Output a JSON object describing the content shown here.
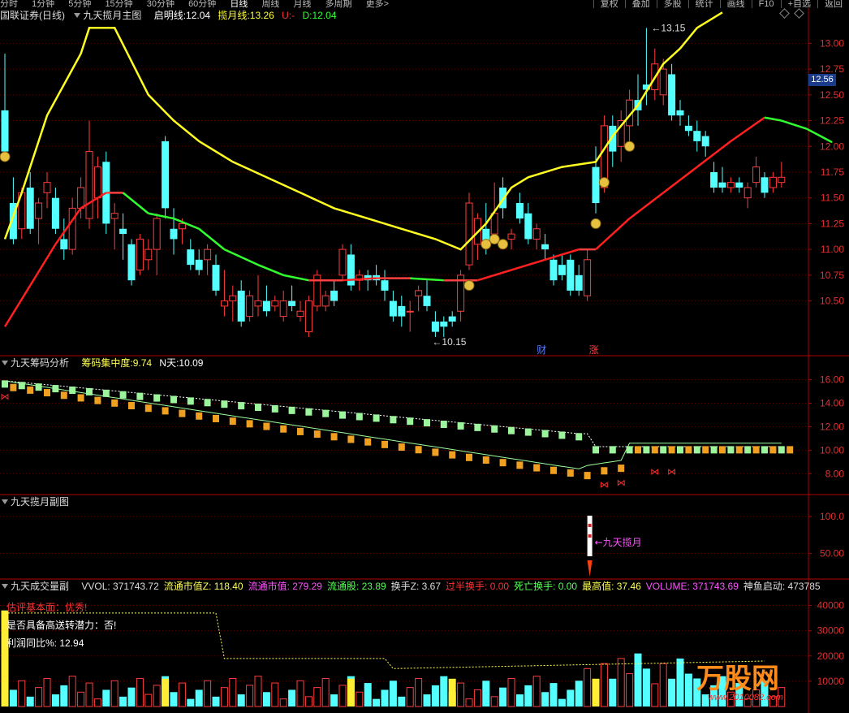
{
  "topbar": {
    "left_items": [
      "分时",
      "1分钟",
      "5分钟",
      "15分钟",
      "30分钟",
      "60分钟",
      "日线",
      "周线",
      "月线",
      "多周期",
      "更多>"
    ],
    "right_items": [
      "复权",
      "叠加",
      "多股",
      "统计",
      "画线",
      "F10",
      "+自选",
      "返回"
    ]
  },
  "main_header": {
    "stock": "国联证券(日线)",
    "indicator": "九天揽月主图",
    "qiming_label": "启明线:",
    "qiming_value": "12.04",
    "lanyue_label": "揽月线:",
    "lanyue_value": "13.26",
    "u_label": "U:",
    "u_value": "-",
    "d_label": "D:",
    "d_value": "12.04"
  },
  "chip_header": {
    "name": "九天筹码分析",
    "conc_label": "筹码集中度:",
    "conc_value": "9.74",
    "n_label": "N天:",
    "n_value": "10.09"
  },
  "sub_header": {
    "name": "九天揽月副图"
  },
  "vol_header": {
    "name": "九天成交量副",
    "items": [
      {
        "label": "VVOL:",
        "value": "371743.72",
        "color": "#dddddd"
      },
      {
        "label": "流通市值Z:",
        "value": "118.40",
        "color": "#ffff55"
      },
      {
        "label": "流通市值:",
        "value": "279.29",
        "color": "#ff55ff"
      },
      {
        "label": "流通股:",
        "value": "23.89",
        "color": "#55ff55"
      },
      {
        "label": "换手Z:",
        "value": "3.67",
        "color": "#dddddd"
      },
      {
        "label": "过半换手:",
        "value": "0.00",
        "color": "#ff3333"
      },
      {
        "label": "死亡换手:",
        "value": "0.00",
        "color": "#55ff55"
      },
      {
        "label": "最高值:",
        "value": "37.46",
        "color": "#ffff55"
      },
      {
        "label": "VOLUME:",
        "value": "371743.69",
        "color": "#ff55ff"
      },
      {
        "label": "神鱼启动:",
        "value": "473785",
        "color": "#dddddd"
      }
    ],
    "info_lines": [
      {
        "text": "估评基本面：优秀!",
        "color": "#ff3333"
      },
      {
        "text": "是否具备高送转潜力：否!",
        "color": "#ffffff"
      },
      {
        "text": "利润同比%: 12.94",
        "color": "#ffffff"
      }
    ]
  },
  "current_price": "12.56",
  "logo_text": "万股网",
  "logo_url": "www.2010082.com",
  "chart_data": [
    {
      "type": "candlestick",
      "name": "main",
      "yticks": [
        "10.50",
        "10.75",
        "11.00",
        "11.25",
        "11.50",
        "11.75",
        "12.00",
        "12.25",
        "12.50",
        "12.75",
        "13.00"
      ],
      "ylim": [
        10.0,
        13.2
      ],
      "candles": [
        [
          12.35,
          12.9,
          12.0,
          11.95
        ],
        [
          11.45,
          11.7,
          11.05,
          11.1
        ],
        [
          11.2,
          11.6,
          11.1,
          11.55
        ],
        [
          11.6,
          11.75,
          11.15,
          11.2
        ],
        [
          11.3,
          11.5,
          11.05,
          11.45
        ],
        [
          11.55,
          11.75,
          11.4,
          11.65
        ],
        [
          11.5,
          11.6,
          11.15,
          11.2
        ],
        [
          11.1,
          11.3,
          10.9,
          11.0
        ],
        [
          11.0,
          11.5,
          10.95,
          11.4
        ],
        [
          11.4,
          11.7,
          11.3,
          11.6
        ],
        [
          11.3,
          12.25,
          11.2,
          11.95
        ],
        [
          11.5,
          11.9,
          11.3,
          11.8
        ],
        [
          11.85,
          11.95,
          11.15,
          11.25
        ],
        [
          11.3,
          11.45,
          11.0,
          11.35
        ],
        [
          11.2,
          11.35,
          10.9,
          11.15
        ],
        [
          11.05,
          11.1,
          10.65,
          10.7
        ],
        [
          10.8,
          11.15,
          10.75,
          11.1
        ],
        [
          10.9,
          11.1,
          10.8,
          11.0
        ],
        [
          11.0,
          11.35,
          10.75,
          11.3
        ],
        [
          12.05,
          12.1,
          11.3,
          11.4
        ],
        [
          11.2,
          11.4,
          10.95,
          11.1
        ],
        [
          11.2,
          11.3,
          11.05,
          11.25
        ],
        [
          11.0,
          11.1,
          10.8,
          10.85
        ],
        [
          10.9,
          11.0,
          10.75,
          10.8
        ],
        [
          10.9,
          11.05,
          10.75,
          11.0
        ],
        [
          10.85,
          10.95,
          10.55,
          10.6
        ],
        [
          10.45,
          10.8,
          10.35,
          10.5
        ],
        [
          10.5,
          10.65,
          10.3,
          10.55
        ],
        [
          10.6,
          10.7,
          10.25,
          10.3
        ],
        [
          10.35,
          10.6,
          10.3,
          10.55
        ],
        [
          10.45,
          10.75,
          10.35,
          10.5
        ],
        [
          10.5,
          10.65,
          10.35,
          10.4
        ],
        [
          10.45,
          10.55,
          10.4,
          10.5
        ],
        [
          10.35,
          10.6,
          10.3,
          10.5
        ],
        [
          10.5,
          10.65,
          10.4,
          10.45
        ],
        [
          10.35,
          10.5,
          10.3,
          10.4
        ],
        [
          10.2,
          10.55,
          10.15,
          10.5
        ],
        [
          10.45,
          10.8,
          10.4,
          10.75
        ],
        [
          10.45,
          10.6,
          10.4,
          10.55
        ],
        [
          10.6,
          10.7,
          10.45,
          10.5
        ],
        [
          10.75,
          11.05,
          10.7,
          11.0
        ],
        [
          10.95,
          11.05,
          10.6,
          10.65
        ],
        [
          10.7,
          10.8,
          10.6,
          10.75
        ],
        [
          10.75,
          10.8,
          10.6,
          10.7
        ],
        [
          10.75,
          10.85,
          10.65,
          10.7
        ],
        [
          10.7,
          10.8,
          10.5,
          10.6
        ],
        [
          10.5,
          10.6,
          10.3,
          10.35
        ],
        [
          10.45,
          10.55,
          10.25,
          10.35
        ],
        [
          10.4,
          10.5,
          10.2,
          10.4
        ],
        [
          10.55,
          10.65,
          10.4,
          10.6
        ],
        [
          10.55,
          10.7,
          10.4,
          10.45
        ],
        [
          10.3,
          10.4,
          10.15,
          10.2
        ],
        [
          10.3,
          10.35,
          10.15,
          10.25
        ],
        [
          10.35,
          10.4,
          10.25,
          10.3
        ],
        [
          10.4,
          10.8,
          10.3,
          10.75
        ],
        [
          10.85,
          11.55,
          10.8,
          11.45
        ],
        [
          11.05,
          11.35,
          10.9,
          11.3
        ],
        [
          11.2,
          11.45,
          10.95,
          11.05
        ],
        [
          11.15,
          11.65,
          11.1,
          11.35
        ],
        [
          11.6,
          11.7,
          11.3,
          11.4
        ],
        [
          11.1,
          11.2,
          11.0,
          11.15
        ],
        [
          11.45,
          11.55,
          11.25,
          11.3
        ],
        [
          11.35,
          11.45,
          11.05,
          11.1
        ],
        [
          11.1,
          11.25,
          11.0,
          11.2
        ],
        [
          11.05,
          11.15,
          10.9,
          11.0
        ],
        [
          10.9,
          10.95,
          10.65,
          10.7
        ],
        [
          10.85,
          10.95,
          10.7,
          10.75
        ],
        [
          10.9,
          10.95,
          10.55,
          10.6
        ],
        [
          10.75,
          10.85,
          10.55,
          10.6
        ],
        [
          10.55,
          11.0,
          10.5,
          10.9
        ],
        [
          11.8,
          12.0,
          11.35,
          11.45
        ],
        [
          11.6,
          12.3,
          11.55,
          12.2
        ],
        [
          12.2,
          12.3,
          11.8,
          11.95
        ],
        [
          12.0,
          12.35,
          11.85,
          12.25
        ],
        [
          12.2,
          12.55,
          12.0,
          12.45
        ],
        [
          12.45,
          12.7,
          12.2,
          12.35
        ],
        [
          12.6,
          13.15,
          12.4,
          12.55
        ],
        [
          12.55,
          12.95,
          12.45,
          12.8
        ],
        [
          12.5,
          12.85,
          12.4,
          12.75
        ],
        [
          12.7,
          12.8,
          12.25,
          12.3
        ],
        [
          12.35,
          12.45,
          12.2,
          12.3
        ],
        [
          12.2,
          12.3,
          12.1,
          12.15
        ],
        [
          12.15,
          12.25,
          11.95,
          12.05
        ],
        [
          12.1,
          12.15,
          11.9,
          12.0
        ],
        [
          11.75,
          11.85,
          11.55,
          11.6
        ],
        [
          11.65,
          11.8,
          11.55,
          11.6
        ],
        [
          11.6,
          11.7,
          11.55,
          11.65
        ],
        [
          11.65,
          11.7,
          11.55,
          11.6
        ],
        [
          11.5,
          11.65,
          11.4,
          11.6
        ],
        [
          11.65,
          11.9,
          11.6,
          11.8
        ],
        [
          11.7,
          11.75,
          11.5,
          11.55
        ],
        [
          11.6,
          11.75,
          11.55,
          11.7
        ],
        [
          11.65,
          11.85,
          11.6,
          11.7
        ]
      ],
      "lanyue_line": [
        [
          0,
          11.1
        ],
        [
          2,
          11.55
        ],
        [
          5,
          12.3
        ],
        [
          9,
          12.9
        ],
        [
          10,
          13.15
        ],
        [
          13,
          13.15
        ],
        [
          17,
          12.5
        ],
        [
          20,
          12.25
        ],
        [
          23,
          12.05
        ],
        [
          27,
          11.85
        ],
        [
          31,
          11.7
        ],
        [
          35,
          11.55
        ],
        [
          39,
          11.4
        ],
        [
          43,
          11.3
        ],
        [
          47,
          11.2
        ],
        [
          51,
          11.1
        ],
        [
          54,
          11.0
        ],
        [
          57,
          11.25
        ],
        [
          60,
          11.6
        ],
        [
          62,
          11.7
        ],
        [
          66,
          11.8
        ],
        [
          70,
          11.85
        ],
        [
          72,
          12.1
        ],
        [
          75,
          12.4
        ],
        [
          78,
          12.8
        ],
        [
          80,
          12.95
        ],
        [
          82,
          13.15
        ],
        [
          85,
          13.3
        ]
      ],
      "qiming_line": [
        [
          0,
          10.25
        ],
        [
          3,
          10.65
        ],
        [
          6,
          11.05
        ],
        [
          9,
          11.4
        ],
        [
          12,
          11.55
        ],
        [
          14,
          11.55
        ],
        [
          17,
          11.35
        ],
        [
          20,
          11.3
        ],
        [
          23,
          11.2
        ],
        [
          26,
          11.0
        ],
        [
          30,
          10.85
        ],
        [
          33,
          10.75
        ],
        [
          36,
          10.7
        ],
        [
          40,
          10.7
        ],
        [
          44,
          10.72
        ],
        [
          48,
          10.72
        ],
        [
          52,
          10.7
        ],
        [
          56,
          10.7
        ],
        [
          60,
          10.8
        ],
        [
          64,
          10.9
        ],
        [
          68,
          11.0
        ],
        [
          70,
          11.0
        ],
        [
          74,
          11.3
        ],
        [
          78,
          11.55
        ],
        [
          82,
          11.8
        ],
        [
          86,
          12.05
        ],
        [
          90,
          12.28
        ],
        [
          92,
          12.25
        ],
        [
          95,
          12.17
        ],
        [
          98,
          12.04
        ]
      ],
      "annotations": [
        "13.15",
        "10.15"
      ],
      "event_labels": [
        "财",
        "涨"
      ]
    },
    {
      "type": "scatter",
      "name": "chip",
      "yticks": [
        "8.00",
        "10.00",
        "12.00",
        "14.00",
        "16.00"
      ],
      "ylim": [
        6.5,
        16.8
      ]
    },
    {
      "type": "scatter",
      "name": "sub",
      "yticks": [
        "50.00",
        "100.0"
      ],
      "ylim": [
        20,
        110
      ],
      "label": "九天揽月"
    },
    {
      "type": "bar",
      "name": "volume",
      "yticks": [
        "10000",
        "20000",
        "30000",
        "40000"
      ],
      "ylim": [
        0,
        45000
      ]
    }
  ]
}
